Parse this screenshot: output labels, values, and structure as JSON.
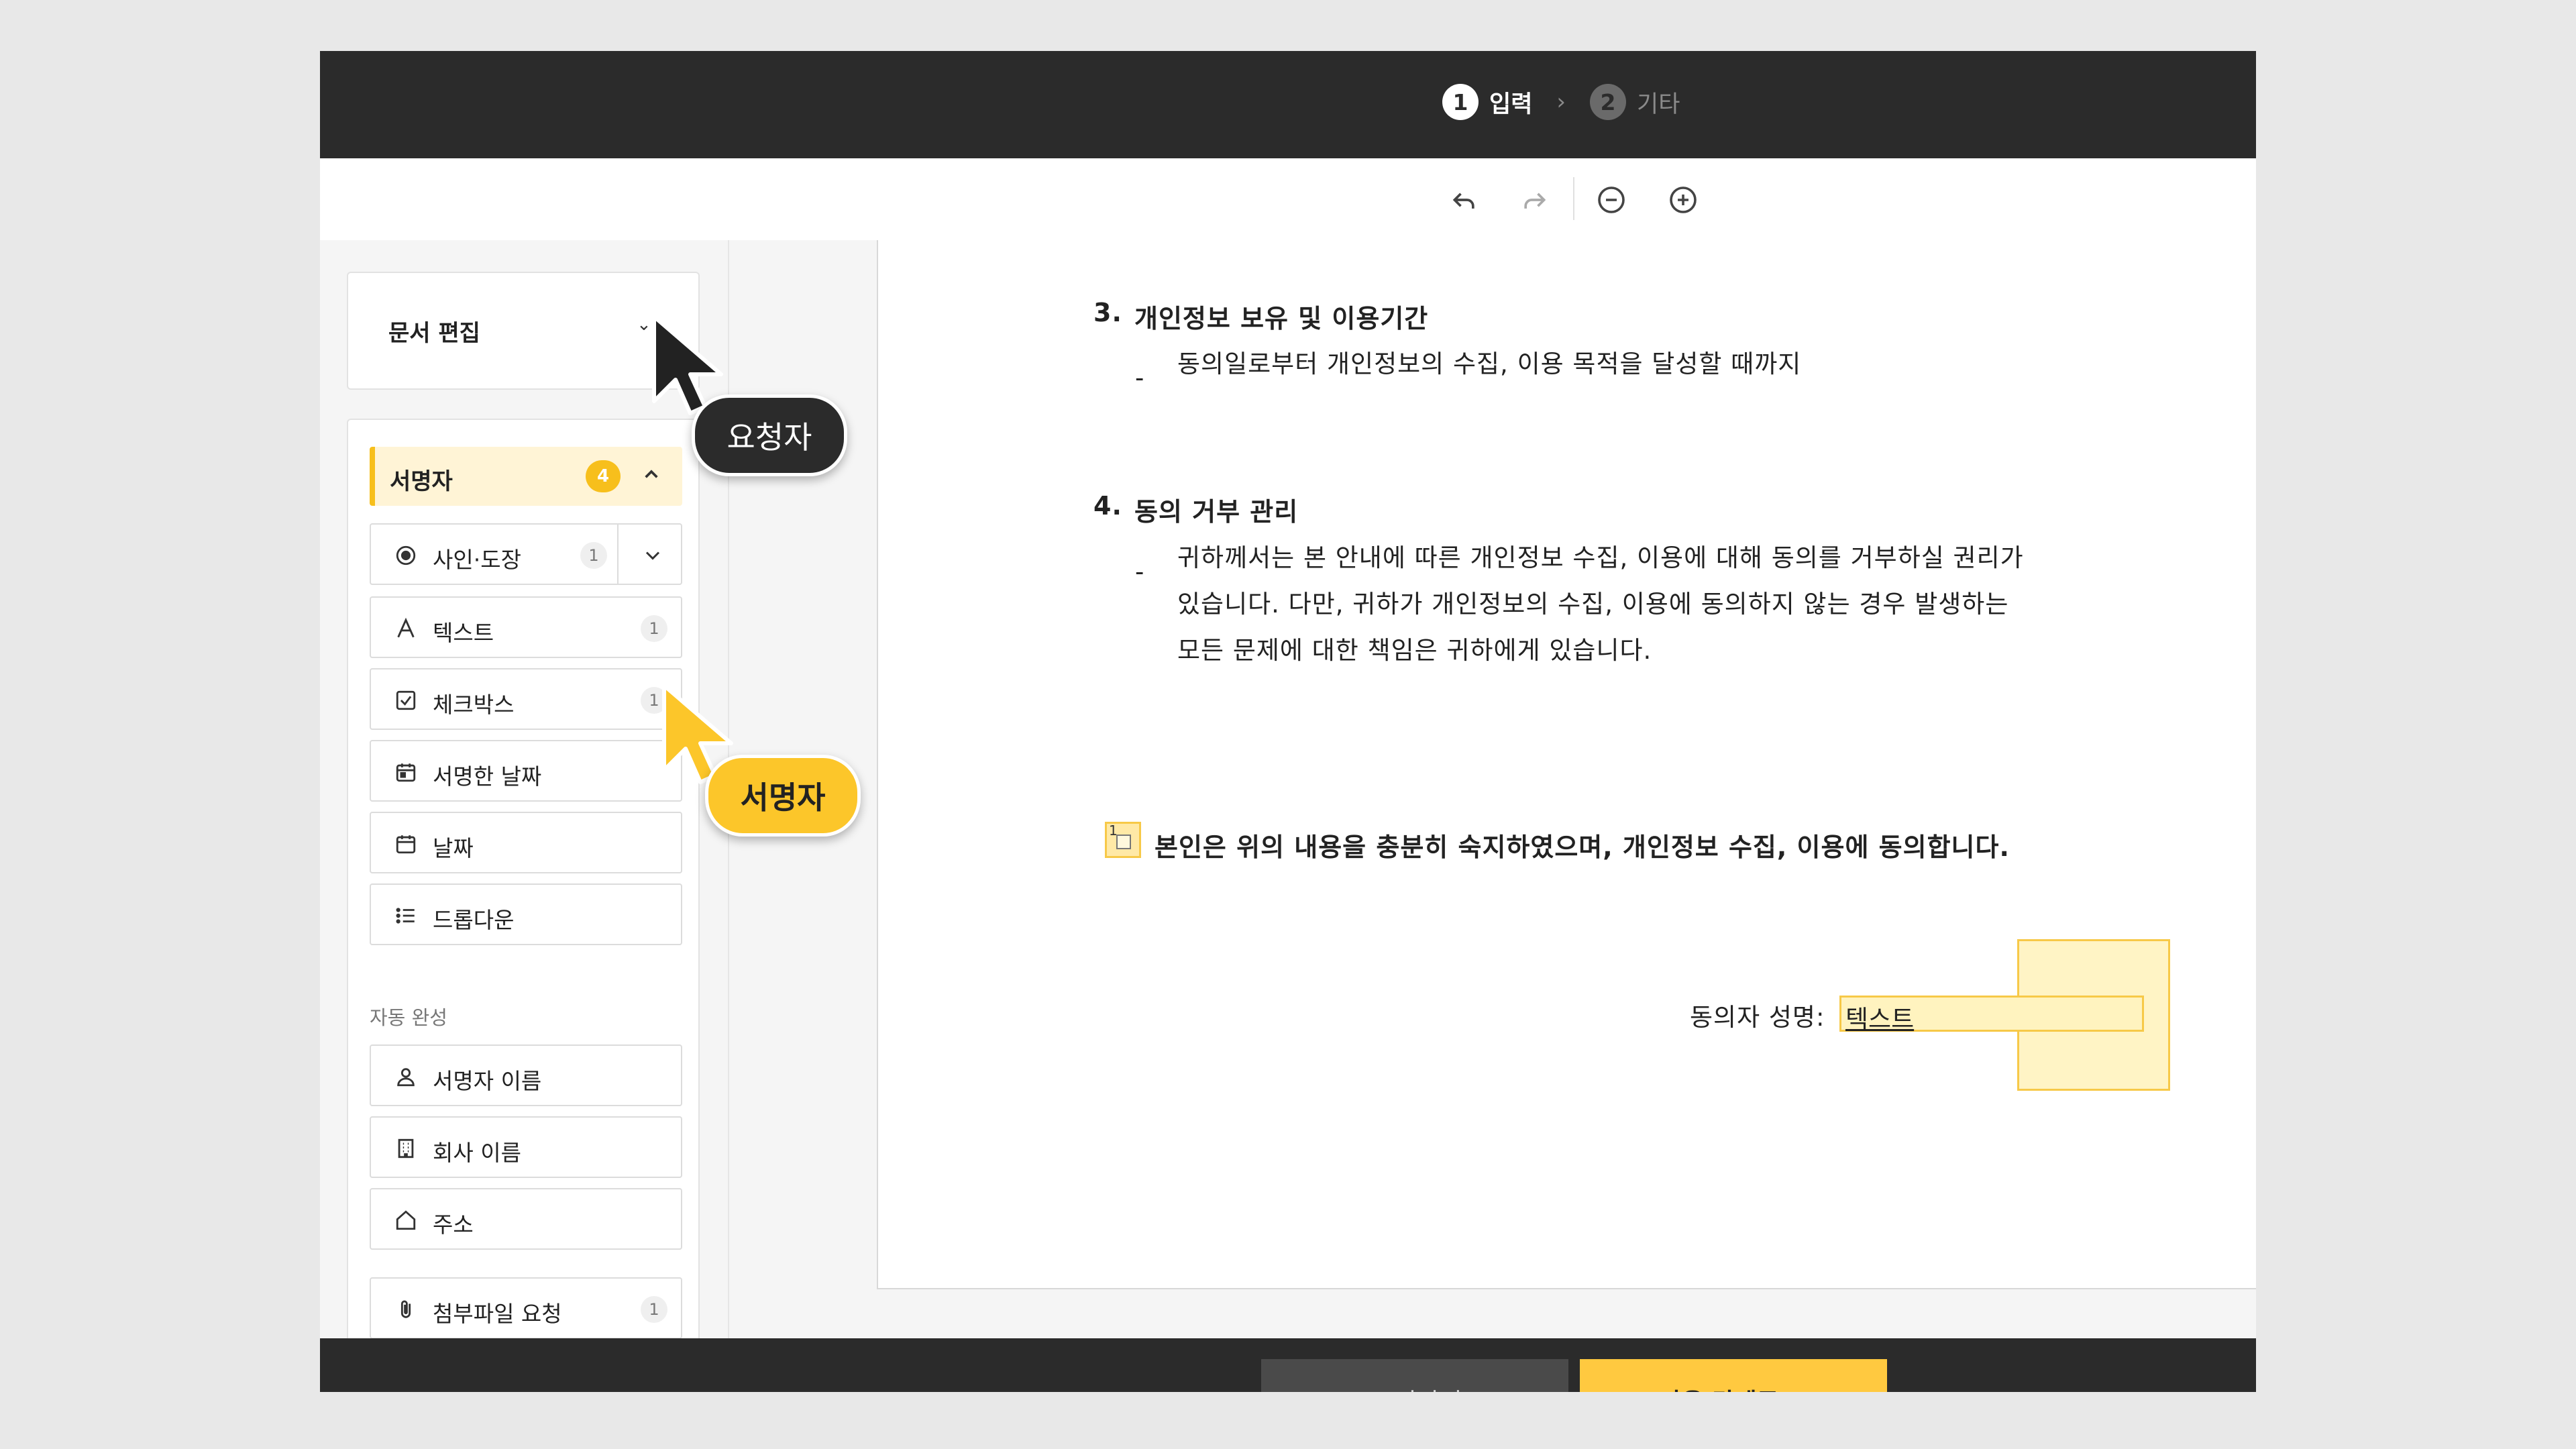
{
  "steps": [
    {
      "num": "1",
      "label": "입력"
    },
    {
      "num": "2",
      "label": "기타"
    }
  ],
  "sidebar": {
    "doc_edit": "문서 편집",
    "signer_label": "서명자",
    "signer_count": "4",
    "fields": [
      {
        "label": "사인·도장",
        "count": "1",
        "icon": "sign-stamp-icon"
      },
      {
        "label": "텍스트",
        "count": "1",
        "icon": "text-icon"
      },
      {
        "label": "체크박스",
        "count": "1",
        "icon": "checkbox-icon"
      },
      {
        "label": "서명한 날짜",
        "icon": "calendar-icon"
      },
      {
        "label": "날짜",
        "icon": "calendar-icon"
      },
      {
        "label": "드롭다운",
        "icon": "list-icon"
      }
    ],
    "auto_complete_label": "자동 완성",
    "auto_fields": [
      {
        "label": "서명자 이름",
        "icon": "person-icon"
      },
      {
        "label": "회사 이름",
        "icon": "building-icon"
      },
      {
        "label": "주소",
        "icon": "home-icon"
      }
    ],
    "attach": {
      "label": "첨부파일 요청",
      "count": "1",
      "icon": "paperclip-icon"
    }
  },
  "document": {
    "section3_num": "3.",
    "section3_title": "개인정보 보유 및 이용기간",
    "section3_bullet": "동의일로부터 개인정보의 수집, 이용 목적을 달성할 때까지",
    "section4_num": "4.",
    "section4_title": "동의 거부 관리",
    "section4_line1": "귀하께서는 본 안내에 따른 개인정보 수집, 이용에 대해 동의를 거부하실 권리가",
    "section4_line2": "있습니다. 다만, 귀하가 개인정보의 수집, 이용에 동의하지 않는 경우 발생하는",
    "section4_line3": "모든 문제에 대한 책임은 귀하에게 있습니다.",
    "bullet_mark": "-",
    "checkbox_number": "1",
    "agree_text": "본인은 위의 내용을 충분히 숙지하였으며, 개인정보 수집, 이용에 동의합니다.",
    "signature_label": "동의자 성명:",
    "signature_field_value": "텍스트"
  },
  "footer": {
    "back": "< 나가기",
    "next": "다음 단계로 >"
  },
  "tooltips": {
    "requester": "요청자",
    "signer": "서명자"
  },
  "colors": {
    "accent": "#ffc940",
    "dark": "#2b2b2b",
    "signer_highlight": "#fff4d6"
  }
}
